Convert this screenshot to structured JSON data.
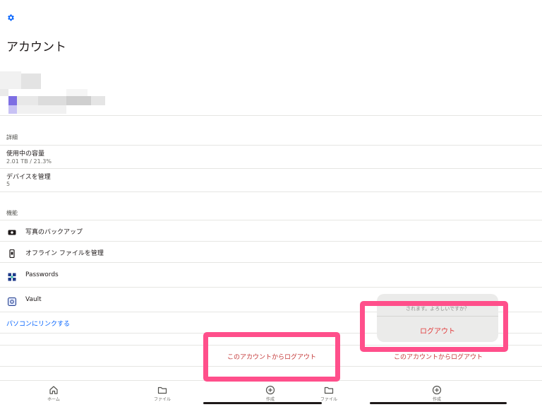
{
  "header": {
    "settings_icon": "gear-icon",
    "title": "アカウント"
  },
  "details": {
    "section_label": "詳細",
    "storage_title": "使用中の容量",
    "storage_value": "2.01 TB / 21.3%",
    "devices_title": "デバイスを管理",
    "devices_value": "5"
  },
  "features": {
    "section_label": "機能",
    "items": [
      {
        "label": "写真のバックアップ",
        "icon": "camera-icon"
      },
      {
        "label": "オフライン ファイルを管理",
        "icon": "phone-icon"
      },
      {
        "label": "Passwords",
        "icon": "passwords-icon"
      },
      {
        "label": "Vault",
        "icon": "vault-icon"
      }
    ],
    "link_label": "パソコンにリンクする"
  },
  "logout": {
    "left_label": "このアカウントからログアウト",
    "right_label": "このアカウントからログアウト"
  },
  "action_sheet": {
    "message": "されます。よろしいですか？",
    "confirm_label": "ログアウト"
  },
  "nav": {
    "left": [
      {
        "label": "ホーム",
        "icon": "home-icon"
      },
      {
        "label": "ファイル",
        "icon": "folder-icon"
      },
      {
        "label": "作成",
        "icon": "plus-circle-icon"
      }
    ],
    "right": [
      {
        "label": "ファイル",
        "icon": "folder-icon"
      },
      {
        "label": "作成",
        "icon": "plus-circle-icon"
      }
    ]
  },
  "colors": {
    "accent": "#0061fe",
    "danger": "#e23a3a",
    "highlight": "#ff4f8b"
  }
}
